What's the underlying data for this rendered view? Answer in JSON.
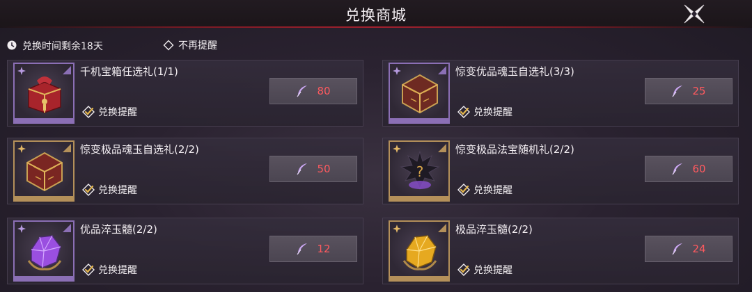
{
  "header": {
    "title": "兑换商城"
  },
  "infobar": {
    "time_left": "兑换时间剩余18天",
    "no_remind": "不再提醒"
  },
  "colors": {
    "price": "#ff5a5f",
    "accent_red": "#a3212e",
    "purple_frame": "#8b6fb5",
    "gold_frame": "#b4905a"
  },
  "items": [
    {
      "name": "千机宝箱任选礼(1/1)",
      "price": "80",
      "remind": "兑换提醒",
      "icon": "red-treasure-chest-icon",
      "quality": "purple"
    },
    {
      "name": "惊变优品魂玉自选礼(3/3)",
      "price": "25",
      "remind": "兑换提醒",
      "icon": "ornate-gem-box-icon",
      "quality": "purple"
    },
    {
      "name": "惊变极品魂玉自选礼(2/2)",
      "price": "50",
      "remind": "兑换提醒",
      "icon": "ornate-gem-box-icon",
      "quality": "gold"
    },
    {
      "name": "惊变极品法宝随机礼(2/2)",
      "price": "60",
      "remind": "兑换提醒",
      "icon": "mystery-artifact-icon",
      "quality": "gold"
    },
    {
      "name": "优品淬玉髓(2/2)",
      "price": "12",
      "remind": "兑换提醒",
      "icon": "purple-crystal-icon",
      "quality": "purple"
    },
    {
      "name": "极品淬玉髓(2/2)",
      "price": "24",
      "remind": "兑换提醒",
      "icon": "gold-crystal-icon",
      "quality": "gold"
    }
  ]
}
